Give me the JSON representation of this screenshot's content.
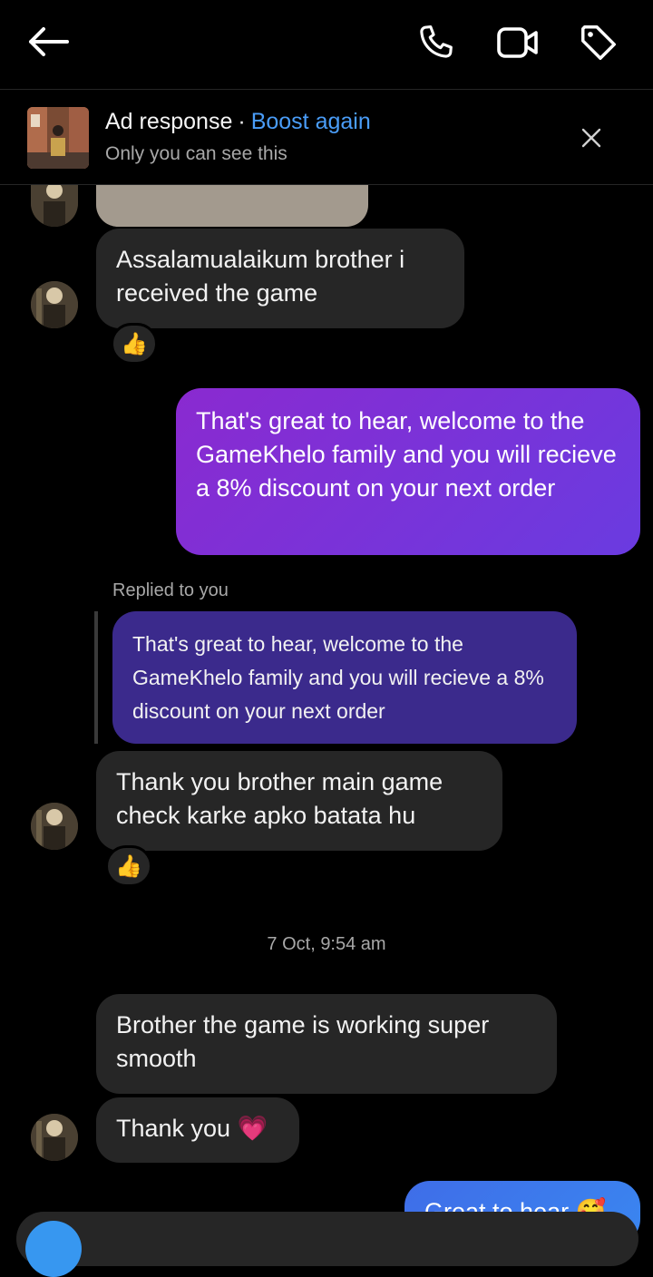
{
  "header": {
    "icons": [
      "back-arrow-icon",
      "phone-icon",
      "video-camera-icon",
      "tag-icon"
    ]
  },
  "ad_banner": {
    "title": "Ad response",
    "separator": "·",
    "action": "Boost again",
    "subtitle": "Only you can see this",
    "close_icon": "close-icon"
  },
  "messages": [
    {
      "side": "in",
      "text": "Assalamualaikum brother i received the game",
      "reaction": "👍"
    },
    {
      "side": "out",
      "text": "That's great to hear, welcome to the GameKhelo family and you will recieve a 8% discount on your next order"
    },
    {
      "side": "in",
      "replied_label": "Replied to you",
      "quote": "That's great to hear, welcome to the GameKhelo family and you will recieve a 8% discount on your next order",
      "text": "Thank you brother main game check karke apko batata hu",
      "reaction": "👍"
    },
    {
      "timestamp": "7 Oct, 9:54 am"
    },
    {
      "side": "in",
      "text": "Brother the game is working super smooth"
    },
    {
      "side": "in",
      "text": "Thank you 💗"
    },
    {
      "side": "out",
      "text": "Great to hear 🥰"
    }
  ],
  "colors": {
    "accent_blue": "#4a9df8",
    "incoming_bubble": "#262626",
    "outgoing_gradient_start": "#8a2ad0",
    "outgoing_gradient_end": "#6a3be0",
    "reply_quote": "#3b2a8c"
  }
}
